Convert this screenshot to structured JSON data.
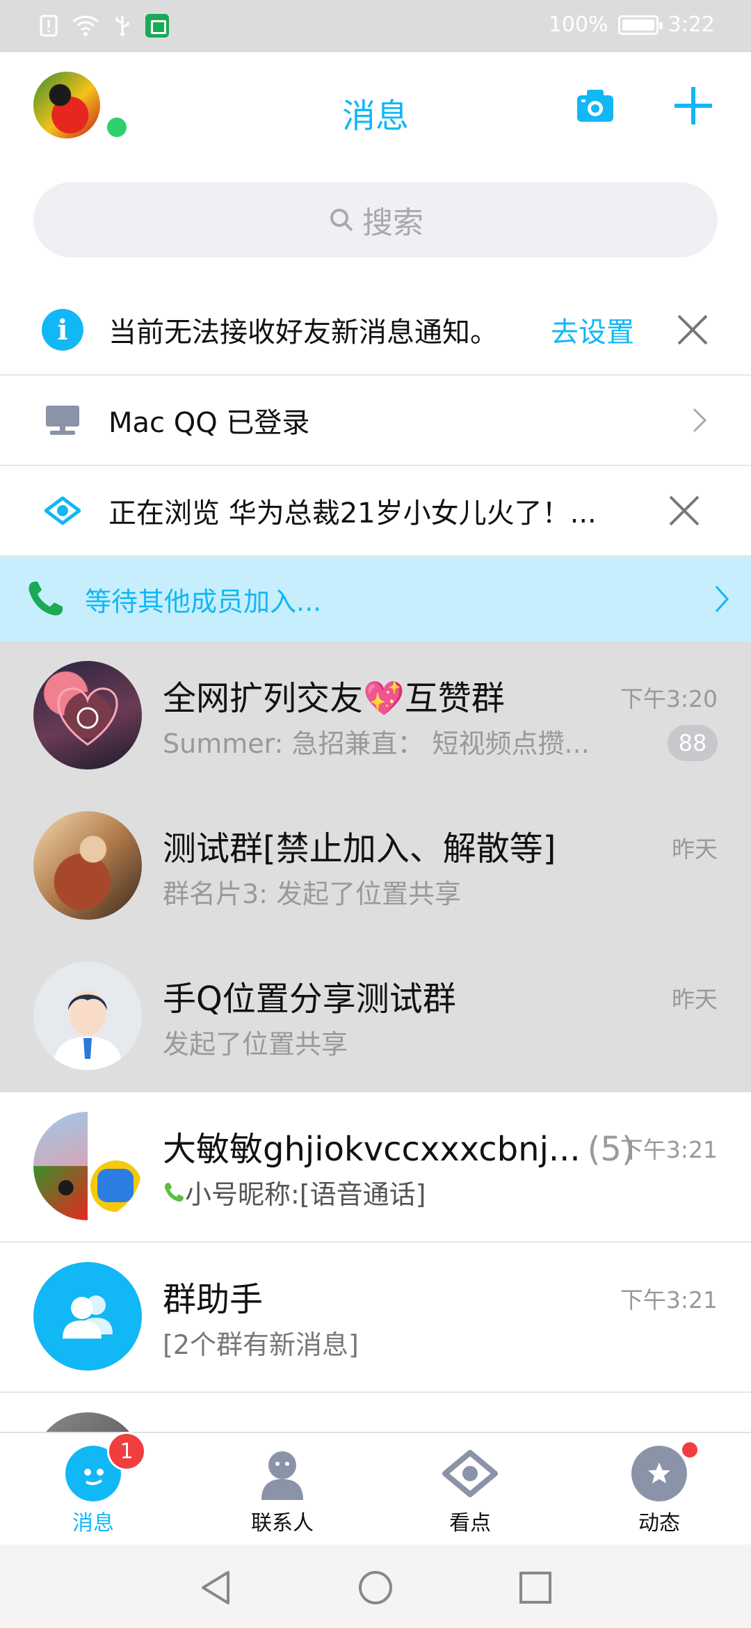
{
  "status_bar": {
    "battery_text": "100%",
    "time": "3:22"
  },
  "header": {
    "title": "消息"
  },
  "search": {
    "placeholder": "搜索"
  },
  "notices": {
    "notification": {
      "text": "当前无法接收好友新消息通知。",
      "action": "去设置"
    },
    "mac_login": {
      "text": "Mac QQ 已登录"
    },
    "browsing": {
      "text": "正在浏览 华为总裁21岁小女儿火了！..."
    }
  },
  "call_bar": {
    "text": "等待其他成员加入..."
  },
  "conversations": [
    {
      "name": "全网扩列交友💖互赞群",
      "message": "Summer: 急招兼直：  短视频点攒...",
      "time": "下午3:20",
      "unread": "88",
      "pinned": true
    },
    {
      "name": "测试群[禁止加入、解散等]",
      "message": "群名片3: 发起了位置共享",
      "time": "昨天",
      "pinned": true
    },
    {
      "name": "手Q位置分享测试群",
      "message": "发起了位置共享",
      "time": "昨天",
      "pinned": true
    },
    {
      "name": "大敏敏ghjiokvccxxxcbnj...",
      "member_count": "(5)",
      "message": "小号昵称:[语音通话]",
      "time": "下午3:21",
      "pinned": false
    },
    {
      "name": "群助手",
      "message": "[2个群有新消息]",
      "time": "下午3:21",
      "pinned": false
    }
  ],
  "bottom_nav": {
    "items": [
      {
        "label": "消息",
        "badge": "1",
        "active": true,
        "icon": "chat-bubble-icon"
      },
      {
        "label": "联系人",
        "icon": "contacts-icon"
      },
      {
        "label": "看点",
        "icon": "eye-icon"
      },
      {
        "label": "动态",
        "icon": "star-icon"
      }
    ]
  },
  "colors": {
    "accent": "#12b7f5",
    "online": "#2ed06d",
    "badge_red": "#f03e3e",
    "call_bar_bg": "#c7eefc",
    "pinned_bg": "#dedede"
  }
}
